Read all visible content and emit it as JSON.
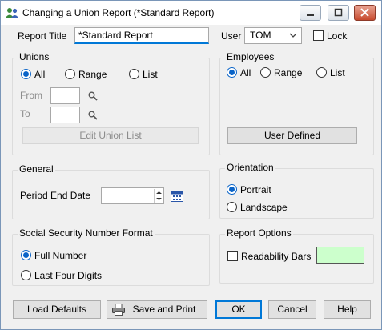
{
  "window": {
    "title": "Changing a Union Report  (*Standard Report)"
  },
  "report_title": {
    "label": "Report Title",
    "value": "*Standard Report"
  },
  "user": {
    "label": "User",
    "value": "TOM"
  },
  "lock": {
    "label": "Lock"
  },
  "unions": {
    "title": "Unions",
    "opt_all": "All",
    "opt_range": "Range",
    "opt_list": "List",
    "from_label": "From",
    "to_label": "To",
    "edit_list": "Edit Union List"
  },
  "employees": {
    "title": "Employees",
    "opt_all": "All",
    "opt_range": "Range",
    "opt_list": "List",
    "user_defined": "User Defined"
  },
  "general": {
    "title": "General",
    "period_end_label": "Period End Date"
  },
  "orientation": {
    "title": "Orientation",
    "portrait": "Portrait",
    "landscape": "Landscape"
  },
  "ssn": {
    "title": "Social Security Number Format",
    "full": "Full Number",
    "last_four": "Last Four Digits"
  },
  "report_options": {
    "title": "Report Options",
    "readability": "Readability Bars",
    "swatch_color": "#ccffcc"
  },
  "footer": {
    "load_defaults": "Load Defaults",
    "save_print": "Save and Print",
    "ok": "OK",
    "cancel": "Cancel",
    "help": "Help"
  }
}
